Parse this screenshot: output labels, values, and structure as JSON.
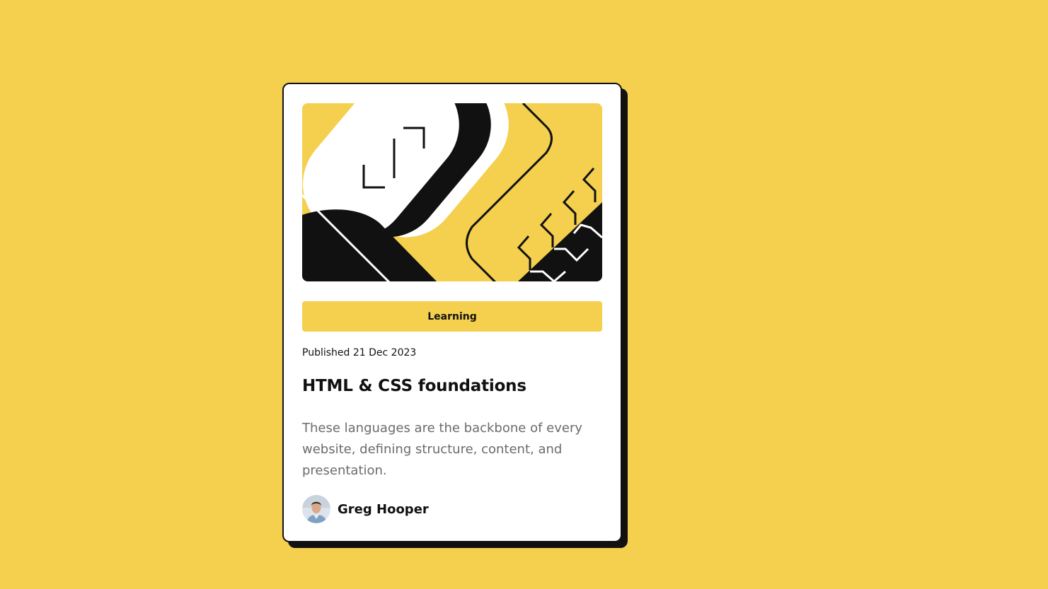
{
  "card": {
    "tag": "Learning",
    "published": "Published 21 Dec 2023",
    "title": "HTML & CSS foundations",
    "description": "These languages are the backbone of every website, defining structure, content, and presentation.",
    "author": {
      "name": "Greg Hooper",
      "avatar_icon": "avatar-photo"
    },
    "hero_icon": "abstract-illustration"
  },
  "colors": {
    "background": "#F4D04E",
    "card": "#FFFFFF",
    "ink": "#111111",
    "muted_text": "#6B6B6B",
    "accent": "#F4D04E"
  }
}
